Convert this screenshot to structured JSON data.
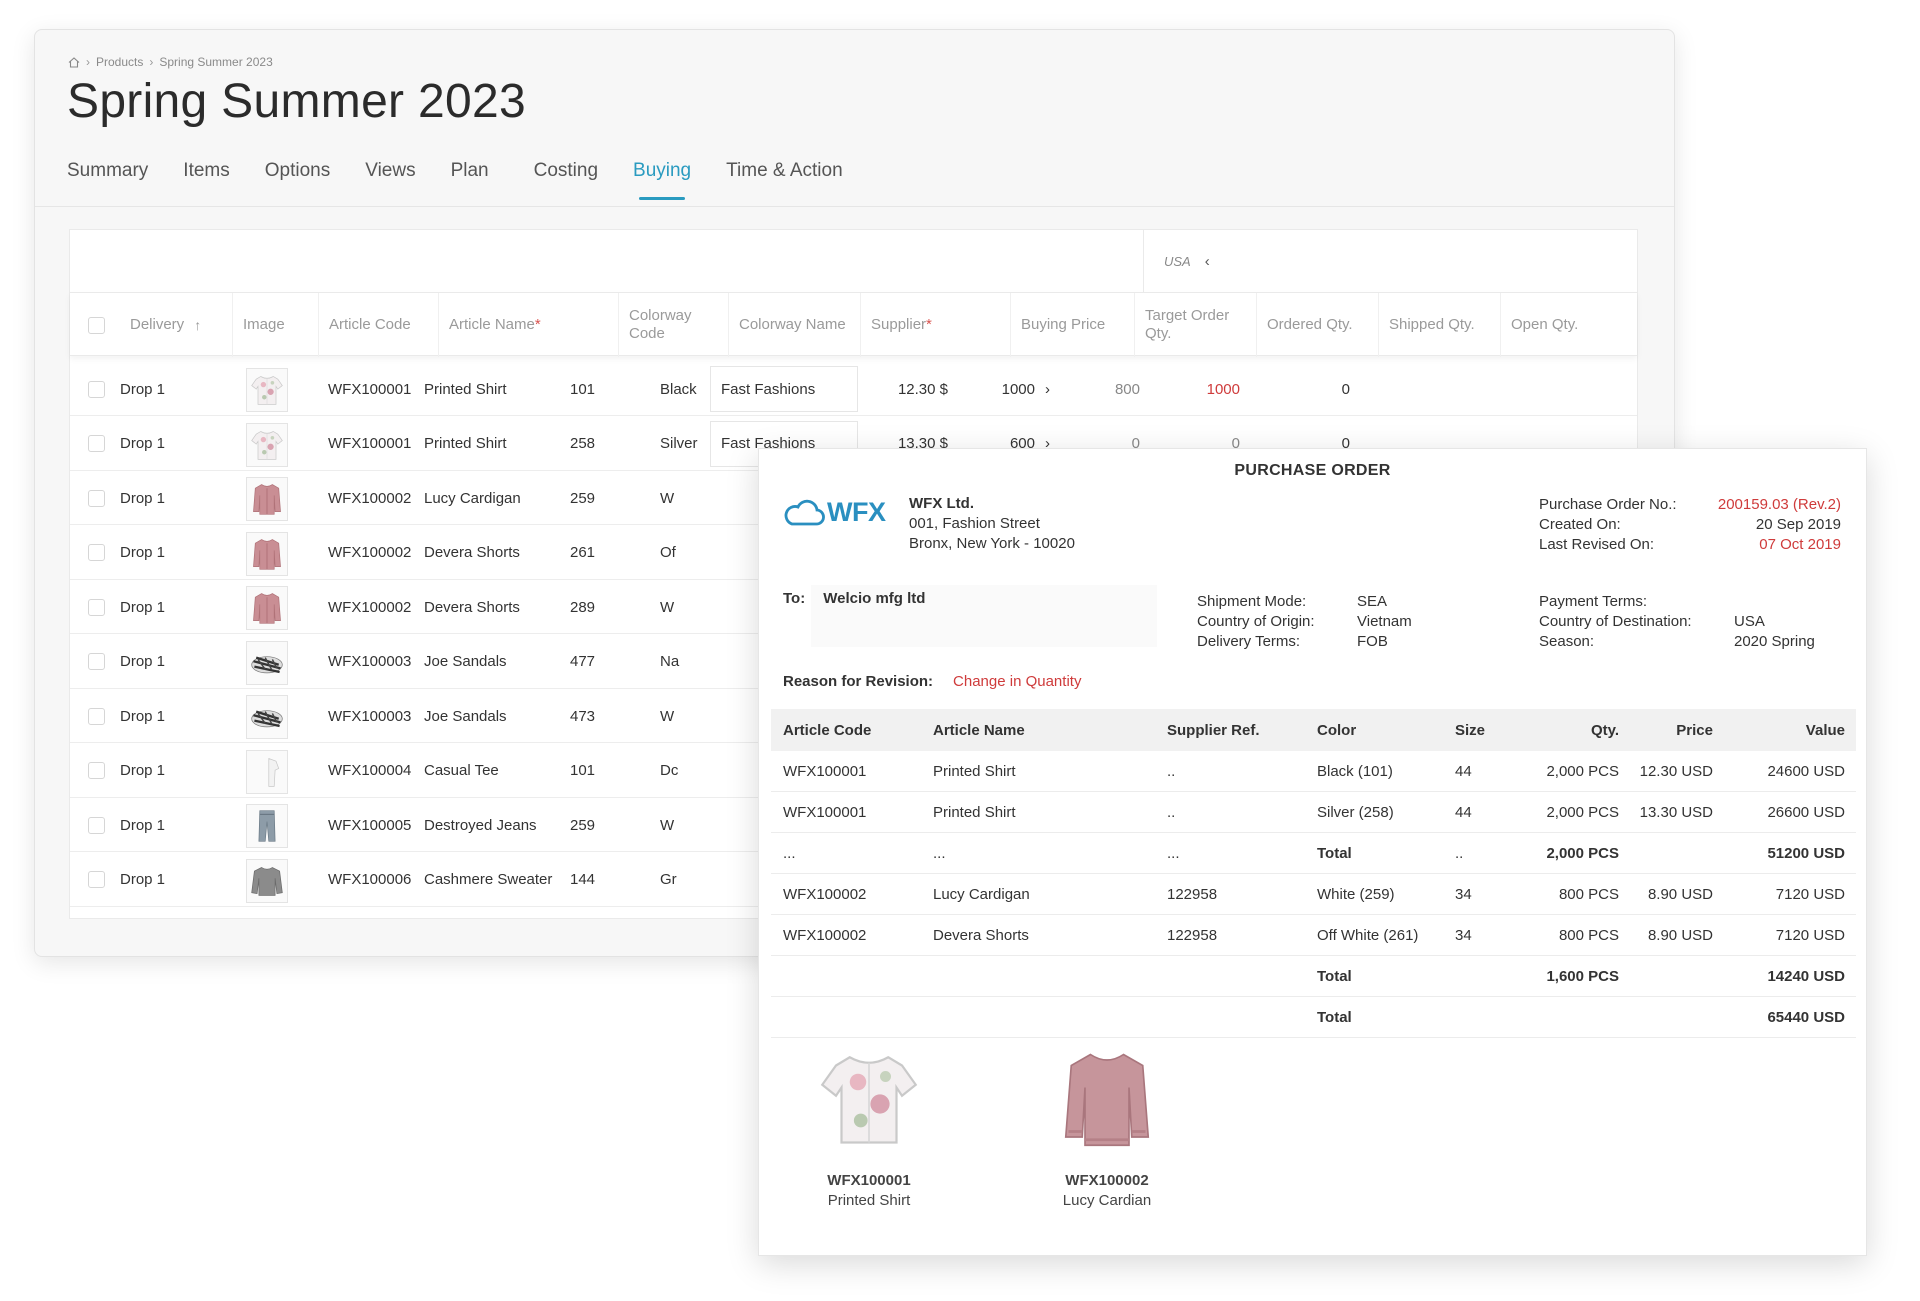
{
  "breadcrumb": {
    "items": [
      "Products",
      "Spring Summer 2023"
    ]
  },
  "page": {
    "title": "Spring Summer 2023"
  },
  "tabs": [
    {
      "label": "Summary"
    },
    {
      "label": "Items"
    },
    {
      "label": "Options"
    },
    {
      "label": "Views"
    },
    {
      "label": "Plan"
    },
    {
      "label": "Costing"
    },
    {
      "label": "Buying",
      "active": true
    },
    {
      "label": "Time & Action"
    }
  ],
  "grid": {
    "region": "USA",
    "headers": {
      "delivery": "Delivery",
      "image": "Image",
      "article_code": "Article Code",
      "article_name": "Article Name",
      "colorway_code": "Colorway Code",
      "colorway_name": "Colorway Name",
      "supplier": "Supplier",
      "buying_price": "Buying Price",
      "target_order_qty": "Target Order Qty.",
      "ordered_qty": "Ordered Qty.",
      "shipped_qty": "Shipped Qty.",
      "open_qty": "Open Qty."
    },
    "rows": [
      {
        "delivery": "Drop 1",
        "image": "shirt",
        "article_code": "WFX100001",
        "article_name": "Printed Shirt",
        "colorway_code": "101",
        "colorway_name": "Black",
        "supplier": "Fast Fashions",
        "buying_price": "12.30 $",
        "target_order_qty": "1000",
        "ordered_qty": "800",
        "shipped_qty": "1000",
        "open_qty": "0"
      },
      {
        "delivery": "Drop 1",
        "image": "shirt",
        "article_code": "WFX100001",
        "article_name": "Printed Shirt",
        "colorway_code": "258",
        "colorway_name": "Silver",
        "supplier": "Fast Fashions",
        "buying_price": "13.30 $",
        "target_order_qty": "600",
        "ordered_qty": "0",
        "shipped_qty": "0",
        "open_qty": "0"
      },
      {
        "delivery": "Drop 1",
        "image": "cardigan",
        "article_code": "WFX100002",
        "article_name": "Lucy Cardigan",
        "colorway_code": "259",
        "colorway_name": "W"
      },
      {
        "delivery": "Drop 1",
        "image": "cardigan",
        "article_code": "WFX100002",
        "article_name": "Devera Shorts",
        "colorway_code": "261",
        "colorway_name": "Of"
      },
      {
        "delivery": "Drop 1",
        "image": "cardigan",
        "article_code": "WFX100002",
        "article_name": "Devera Shorts",
        "colorway_code": "289",
        "colorway_name": "W"
      },
      {
        "delivery": "Drop 1",
        "image": "sandal",
        "article_code": "WFX100003",
        "article_name": "Joe Sandals",
        "colorway_code": "477",
        "colorway_name": "Na"
      },
      {
        "delivery": "Drop 1",
        "image": "sandal",
        "article_code": "WFX100003",
        "article_name": "Joe Sandals",
        "colorway_code": "473",
        "colorway_name": "W"
      },
      {
        "delivery": "Drop 1",
        "image": "tee",
        "article_code": "WFX100004",
        "article_name": "Casual Tee",
        "colorway_code": "101",
        "colorway_name": "Dc"
      },
      {
        "delivery": "Drop 1",
        "image": "jeans",
        "article_code": "WFX100005",
        "article_name": "Destroyed Jeans",
        "colorway_code": "259",
        "colorway_name": "W"
      },
      {
        "delivery": "Drop 1",
        "image": "sweater",
        "article_code": "WFX100006",
        "article_name": "Cashmere Sweater",
        "colorway_code": "144",
        "colorway_name": "Gr"
      }
    ]
  },
  "po": {
    "title": "PURCHASE ORDER",
    "logo_text": "WFX",
    "company": {
      "name": "WFX Ltd.",
      "address1": "001, Fashion Street",
      "address2": "Bronx, New York - 10020"
    },
    "meta": {
      "po_no_label": "Purchase Order No.:",
      "po_no": "200159.03 (Rev.2)",
      "created_label": "Created On:",
      "created": "20 Sep 2019",
      "revised_label": "Last Revised On:",
      "revised": "07 Oct 2019"
    },
    "to_label": "To:",
    "to": "Welcio mfg ltd",
    "shipment": {
      "mode_label": "Shipment Mode:",
      "mode": "SEA",
      "origin_label": "Country of Origin:",
      "origin": "Vietnam",
      "terms_label": "Delivery Terms:",
      "terms": "FOB"
    },
    "payment": {
      "terms_label": "Payment Terms:",
      "terms": "",
      "dest_label": "Country of Destination:",
      "dest": "USA",
      "season_label": "Season:",
      "season": "2020 Spring"
    },
    "reason_label": "Reason for Revision:",
    "reason": "Change in Quantity",
    "table": {
      "headers": {
        "article_code": "Article Code",
        "article_name": "Article Name",
        "supplier_ref": "Supplier Ref.",
        "color": "Color",
        "size": "Size",
        "qty": "Qty.",
        "price": "Price",
        "value": "Value"
      },
      "rows": [
        {
          "article_code": "WFX100001",
          "article_name": "Printed Shirt",
          "supplier_ref": "..",
          "color": "Black (101)",
          "size": "44",
          "qty": "2,000 PCS",
          "price": "12.30 USD",
          "value": "24600 USD"
        },
        {
          "article_code": "WFX100001",
          "article_name": "Printed Shirt",
          "supplier_ref": "..",
          "color": "Silver (258)",
          "size": "44",
          "qty": "2,000 PCS",
          "price": "13.30 USD",
          "value": "26600 USD"
        },
        {
          "article_code": "...",
          "article_name": "...",
          "supplier_ref": "...",
          "color": "Total",
          "size": "..",
          "qty": "2,000 PCS",
          "price": "",
          "value": "51200 USD",
          "total": true
        },
        {
          "article_code": "WFX100002",
          "article_name": "Lucy Cardigan",
          "supplier_ref": "122958",
          "color": "White (259)",
          "size": "34",
          "qty": "800 PCS",
          "price": "8.90 USD",
          "value": "7120 USD"
        },
        {
          "article_code": "WFX100002",
          "article_name": "Devera Shorts",
          "supplier_ref": "122958",
          "color": "Off White (261)",
          "size": "34",
          "qty": "800 PCS",
          "price": "8.90 USD",
          "value": "7120 USD"
        },
        {
          "article_code": "",
          "article_name": "",
          "supplier_ref": "",
          "color": "Total",
          "size": "",
          "qty": "1,600 PCS",
          "price": "",
          "value": "14240 USD",
          "total": true
        },
        {
          "article_code": "",
          "article_name": "",
          "supplier_ref": "",
          "color": "Total",
          "size": "",
          "qty": "",
          "price": "",
          "value": "65440 USD",
          "total": true
        }
      ]
    },
    "products": [
      {
        "code": "WFX100001",
        "name": "Printed Shirt",
        "image": "shirt"
      },
      {
        "code": "WFX100002",
        "name": "Lucy Cardian",
        "image": "sweater-pink"
      }
    ]
  },
  "colors": {
    "accent": "#2a9bc0",
    "alert": "#cf3b3b"
  }
}
